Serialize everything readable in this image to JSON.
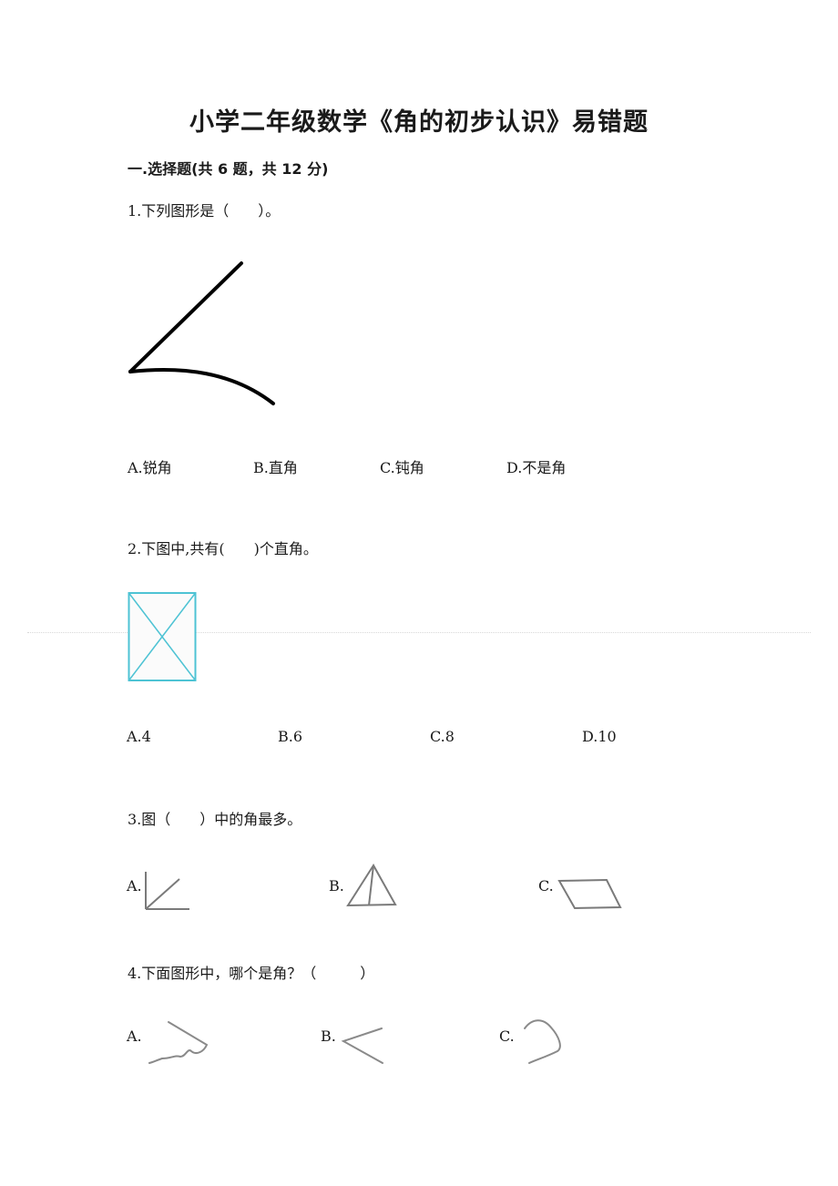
{
  "title": "小学二年级数学《角的初步认识》易错题",
  "section": "一.选择题(共 6 题，共 12 分)",
  "questions": [
    {
      "stem": "1.下列图形是（　　）。",
      "figure": "open-curve-angle",
      "options": [
        "A.锐角",
        "B.直角",
        "C.钝角",
        "D.不是角"
      ]
    },
    {
      "stem": "2.下图中,共有(　　)个直角。",
      "figure": "rectangle-with-diagonals",
      "figure_color": "#4ec3d4",
      "options": [
        "A.4",
        "B.6",
        "C.8",
        "D.10"
      ]
    },
    {
      "stem": "3.图（　　）中的角最多。",
      "options": [
        {
          "label": "A.",
          "figure": "two-rays-angle"
        },
        {
          "label": "B.",
          "figure": "triangle-split"
        },
        {
          "label": "C.",
          "figure": "parallelogram"
        }
      ]
    },
    {
      "stem": "4.下面图形中，哪个是角？（　　　）",
      "options": [
        {
          "label": "A.",
          "figure": "wavy-line-angle"
        },
        {
          "label": "B.",
          "figure": "straight-angle"
        },
        {
          "label": "C.",
          "figure": "curved-hook"
        }
      ]
    }
  ]
}
